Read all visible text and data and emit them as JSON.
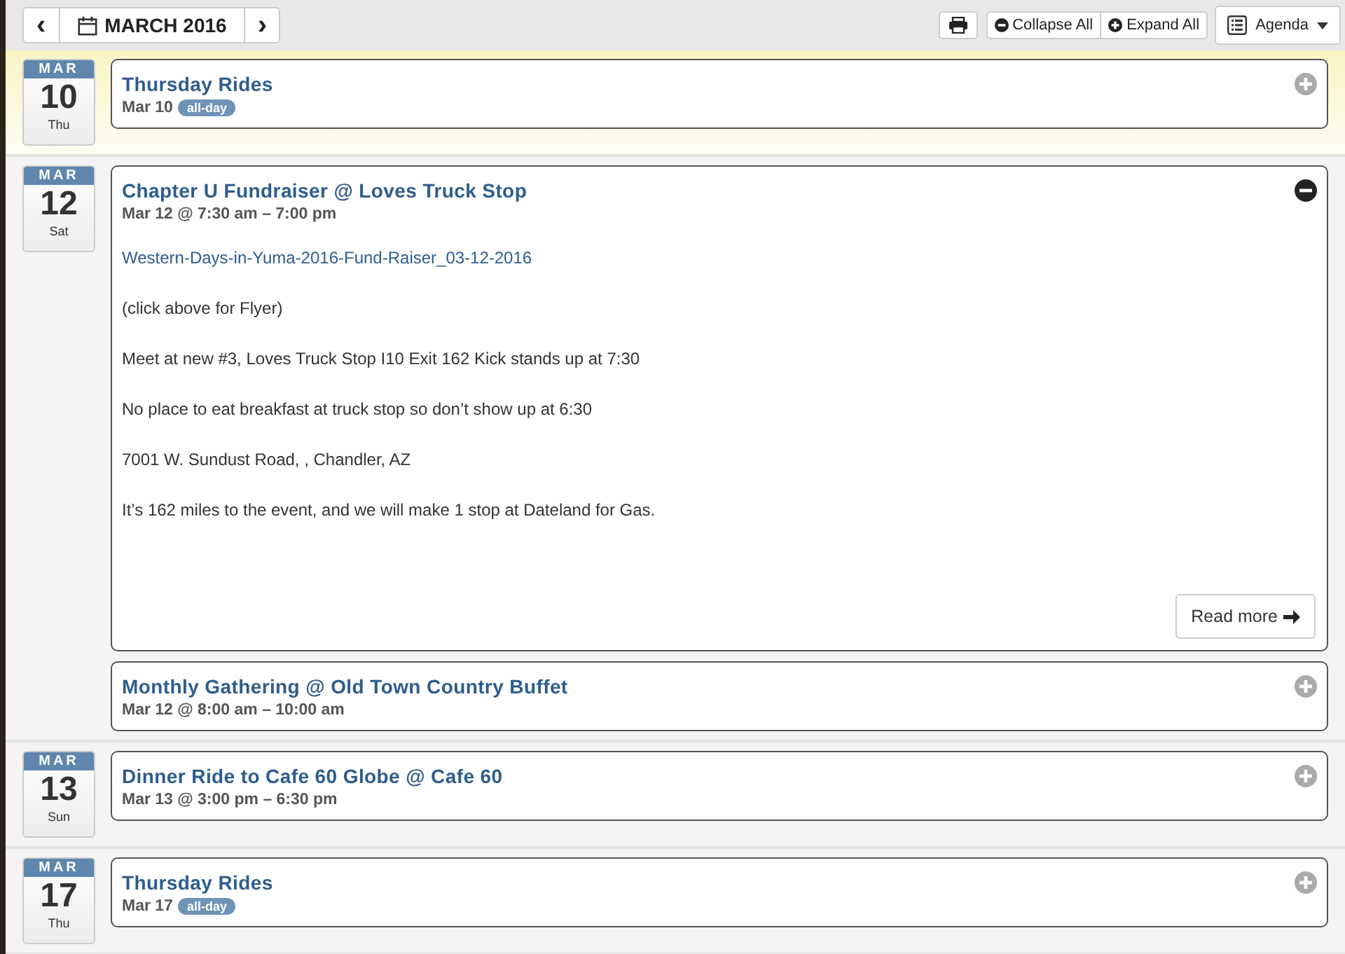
{
  "toolbar": {
    "prev": "‹",
    "month": "MARCH 2016",
    "next": "›",
    "collapse_all": "Collapse All",
    "expand_all": "Expand All",
    "view": "Agenda"
  },
  "days": [
    {
      "month": "MAR",
      "day": "10",
      "weekday": "Thu",
      "today": true,
      "events": [
        {
          "title": "Thursday Rides",
          "time": "Mar 10",
          "badge": "all-day",
          "expanded": false
        }
      ]
    },
    {
      "month": "MAR",
      "day": "12",
      "weekday": "Sat",
      "today": false,
      "events": [
        {
          "title": "Chapter U Fundraiser @ Loves Truck Stop",
          "time": "Mar 12 @ 7:30 am – 7:00 pm",
          "expanded": true,
          "link": "Western-Days-in-Yuma-2016-Fund-Raiser_03-12-2016",
          "paragraphs": [
            "(click above for Flyer)",
            "Meet at new #3, Loves Truck Stop I10 Exit 162 Kick stands up at 7:30",
            "No place to eat breakfast at truck stop so don’t show up at 6:30",
            "7001 W. Sundust Road, , Chandler, AZ",
            "It’s 162 miles to the event, and we will make 1 stop at Dateland for Gas."
          ],
          "read_more": "Read more"
        },
        {
          "title": "Monthly Gathering @ Old Town Country Buffet",
          "time": "Mar 12 @ 8:00 am – 10:00 am",
          "expanded": false
        }
      ]
    },
    {
      "month": "MAR",
      "day": "13",
      "weekday": "Sun",
      "today": false,
      "events": [
        {
          "title": "Dinner Ride to Cafe 60 Globe @ Cafe 60",
          "time": "Mar 13 @ 3:00 pm – 6:30 pm",
          "expanded": false
        }
      ]
    },
    {
      "month": "MAR",
      "day": "17",
      "weekday": "Thu",
      "today": false,
      "events": [
        {
          "title": "Thursday Rides",
          "time": "Mar 17",
          "badge": "all-day",
          "expanded": false
        }
      ]
    }
  ]
}
